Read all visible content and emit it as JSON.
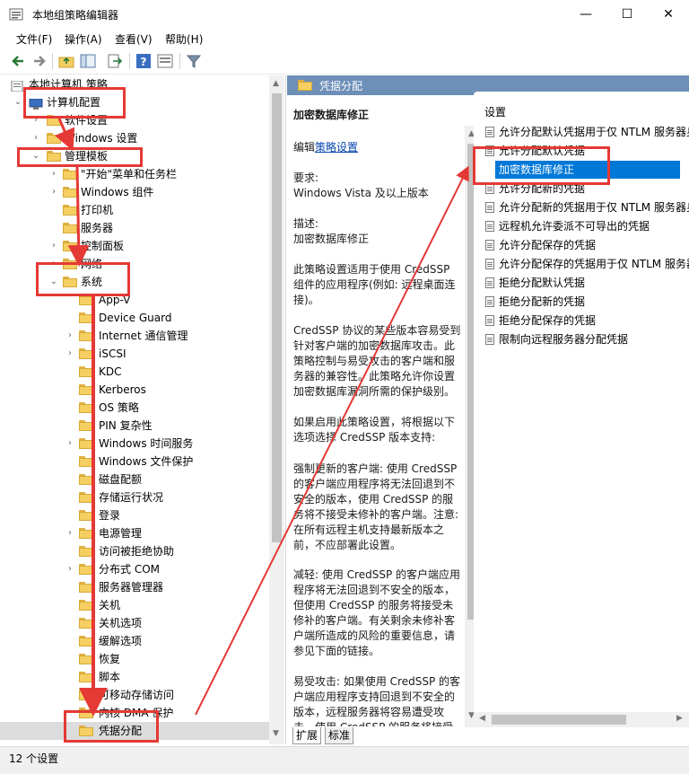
{
  "window": {
    "title": "本地组策略编辑器",
    "minimize_glyph": "—",
    "maximize_glyph": "☐",
    "close_glyph": "✕"
  },
  "menu": [
    "文件(F)",
    "操作(A)",
    "查看(V)",
    "帮助(H)"
  ],
  "toolbar": [
    "back-icon",
    "forward-icon",
    "up-folder-icon",
    "show-hide-tree-icon",
    "export-list-icon",
    "help-icon",
    "properties-icon",
    "filter-icon"
  ],
  "tree": {
    "root": "本地计算机 策略",
    "computer_config": "计算机配置",
    "software_settings": "软件设置",
    "windows_settings": "Windows 设置",
    "admin_templates": "管理模板",
    "start_menu": "\"开始\"菜单和任务栏",
    "windows_components": "Windows 组件",
    "printers": "打印机",
    "server": "服务器",
    "control_panel": "控制面板",
    "network": "网络",
    "system": "系统",
    "system_children": [
      "App-V",
      "Device Guard",
      "Internet 通信管理",
      "iSCSI",
      "KDC",
      "Kerberos",
      "OS 策略",
      "PIN 复杂性",
      "Windows 时间服务",
      "Windows 文件保护",
      "磁盘配额",
      "存储运行状况",
      "登录",
      "电源管理",
      "访问被拒绝协助",
      "分布式 COM",
      "服务器管理器",
      "关机",
      "关机选项",
      "缓解选项",
      "恢复",
      "脚本",
      "可移动存储访问",
      "内核 DMA 保护",
      "凭据分配"
    ]
  },
  "middle": {
    "header": "凭据分配",
    "policy_title": "加密数据库修正",
    "edit_prefix": "编辑",
    "edit_link": "策略设置",
    "requirements_label": "要求:",
    "requirements": "Windows Vista 及以上版本",
    "description_label": "描述:",
    "description": "加密数据库修正",
    "para1": "此策略设置适用于使用 CredSSP 组件的应用程序(例如: 远程桌面连接)。",
    "para2": "CredSSP 协议的某些版本容易受到针对客户端的加密数据库攻击。此策略控制与易受攻击的客户端和服务器的兼容性。此策略允许你设置加密数据库漏洞所需的保护级别。",
    "para3": "如果启用此策略设置，将根据以下选项选择 CredSSP 版本支持:",
    "para4": "强制更新的客户端: 使用 CredSSP 的客户端应用程序将无法回退到不安全的版本，使用 CredSSP 的服务将不接受未修补的客户端。注意: 在所有远程主机支持最新版本之前，不应部署此设置。",
    "para5": "减轻: 使用 CredSSP 的客户端应用程序将无法回退到不安全的版本，但使用 CredSSP 的服务将接受未修补的客户端。有关剩余未修补客户端所造成的风险的重要信息，请参见下面的链接。",
    "para6": "易受攻击: 如果使用 CredSSP 的客户端应用程序支持回退到不安全的版本，远程服务器将容易遭受攻击。使用 CredSSP 的服务将接受"
  },
  "right": {
    "column_header": "设置",
    "items": [
      "允许分配默认凭据用于仅 NTLM 服务器身份验证",
      "允许分配默认凭据",
      "加密数据库修正",
      "允许分配新的凭据",
      "允许分配新的凭据用于仅 NTLM 服务器身份验证",
      "远程机允许委派不可导出的凭据",
      "允许分配保存的凭据",
      "允许分配保存的凭据用于仅 NTLM 服务器身份验证",
      "拒绝分配默认凭据",
      "拒绝分配新的凭据",
      "拒绝分配保存的凭据",
      "限制向远程服务器分配凭据"
    ]
  },
  "tabs": [
    "扩展",
    "标准"
  ],
  "status": "12 个设置",
  "colors": {
    "header_blue": "#6d8fb8",
    "selection_blue": "#0078d7",
    "annotation_red": "#e53935",
    "folder_yellow": "#f5cf62"
  }
}
